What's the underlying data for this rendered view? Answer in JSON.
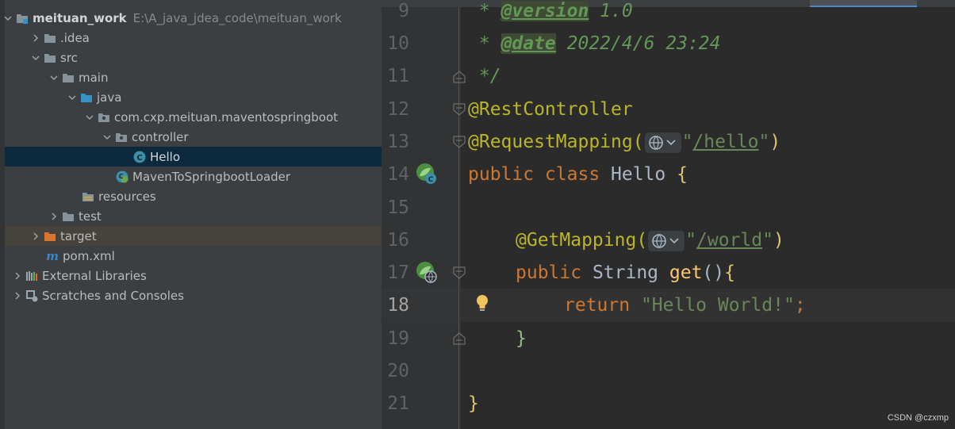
{
  "project_tree": {
    "root": {
      "name": "meituan_work",
      "path": "E:\\A_java_jdea_code\\meituan_work"
    },
    "items": [
      {
        "label": "meituan_work",
        "path": "E:\\A_java_jdea_code\\meituan_work"
      },
      {
        "label": ".idea"
      },
      {
        "label": "src"
      },
      {
        "label": "main"
      },
      {
        "label": "java"
      },
      {
        "label": "com.cxp.meituan.maventospringboot"
      },
      {
        "label": "controller"
      },
      {
        "label": "Hello"
      },
      {
        "label": "MavenToSpringbootLoader"
      },
      {
        "label": "resources"
      },
      {
        "label": "test"
      },
      {
        "label": "target"
      },
      {
        "label": "pom.xml"
      },
      {
        "label": "External Libraries"
      },
      {
        "label": "Scratches and Consoles"
      }
    ]
  },
  "editor": {
    "line_numbers": [
      "9",
      "10",
      "11",
      "12",
      "13",
      "14",
      "15",
      "16",
      "17",
      "18",
      "19",
      "20",
      "21"
    ],
    "current_line": "18",
    "tokens": {
      "l9_star": " * ",
      "l9_tag": "@version",
      "l9_val": " 1.0",
      "l10_star": " * ",
      "l10_tag": "@date",
      "l10_val": " 2022/4/6 23:24",
      "l11": " */",
      "l12": "@RestController",
      "l13_ann": "@RequestMapping(",
      "l13_str_open": "\"",
      "l13_path": "/hello",
      "l13_str_close": "\"",
      "l13_close": ")",
      "l14_kw": "public class ",
      "l14_name": "Hello ",
      "l14_brace": "{",
      "l16_ann": "@GetMapping(",
      "l16_str_open": "\"",
      "l16_path": "/world",
      "l16_str_close": "\"",
      "l16_close": ")",
      "l17_kw": "public ",
      "l17_type": "String ",
      "l17_fn": "get",
      "l17_paren": "()",
      "l17_brace": "{",
      "l18_kw": "return ",
      "l18_str": "\"Hello World!\"",
      "l18_semi": ";",
      "l19": "}",
      "l21": "}"
    }
  },
  "watermark": "CSDN @czxmp",
  "colors": {
    "keyword": "#cc7832",
    "annotation": "#bbb529",
    "string": "#6a8759",
    "doc_comment": "#629755",
    "function": "#ffc66d",
    "selection": "#0d293e"
  },
  "icons": {
    "folder": "folder-icon",
    "package": "package-icon",
    "class": "class-icon",
    "spring_boot": "spring-boot-icon",
    "maven": "maven-icon",
    "bulb": "lightbulb-icon",
    "web": "globe-icon"
  }
}
